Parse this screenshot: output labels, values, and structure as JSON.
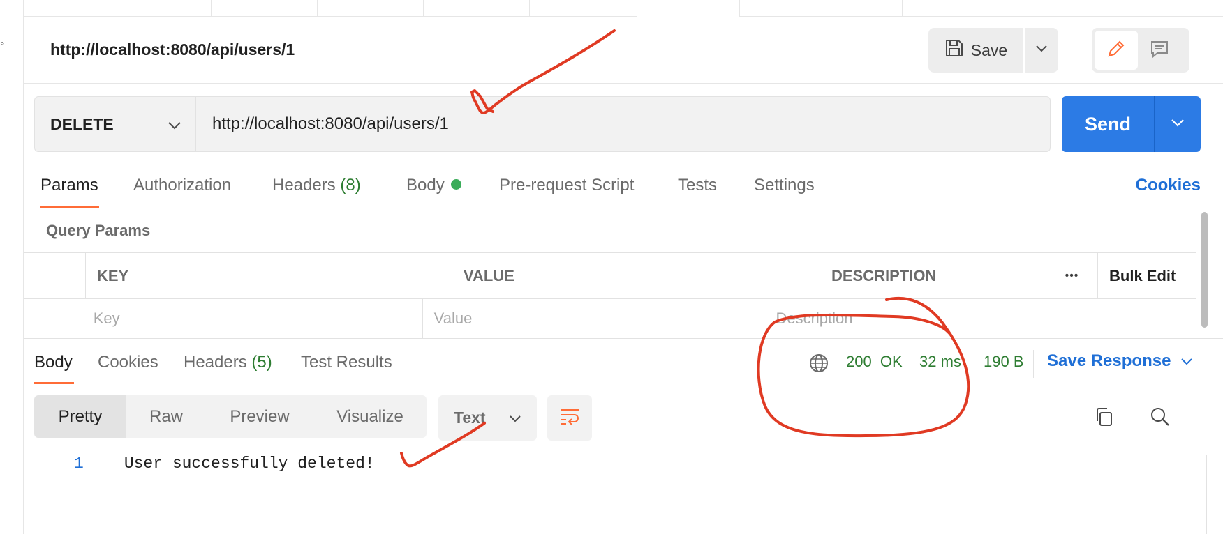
{
  "request": {
    "title": "http://localhost:8080/api/users/1",
    "save_label": "Save",
    "method": "DELETE",
    "url": "http://localhost:8080/api/users/1",
    "send_label": "Send"
  },
  "request_tabs": {
    "params": "Params",
    "authorization": "Authorization",
    "headers": "Headers",
    "headers_count": "(8)",
    "body": "Body",
    "pre_request": "Pre-request Script",
    "tests": "Tests",
    "settings": "Settings",
    "cookies": "Cookies"
  },
  "query_params": {
    "label": "Query Params",
    "columns": [
      "KEY",
      "VALUE",
      "DESCRIPTION"
    ],
    "more_icon": "•••",
    "bulk_edit": "Bulk Edit",
    "placeholders": [
      "Key",
      "Value",
      "Description"
    ]
  },
  "response": {
    "tabs": {
      "body": "Body",
      "cookies": "Cookies",
      "headers": "Headers",
      "headers_count": "(5)",
      "test_results": "Test Results"
    },
    "status_code": "200",
    "status_text": "OK",
    "time": "32 ms",
    "size": "190 B",
    "save_response": "Save Response",
    "view_tabs": [
      "Pretty",
      "Raw",
      "Preview",
      "Visualize"
    ],
    "format": "Text",
    "line_number": "1",
    "body_text": "User successfully deleted!"
  },
  "colors": {
    "accent_orange": "#ff6c37",
    "send_blue": "#2c7be5",
    "link_blue": "#1f6fd6",
    "status_green": "#2e7d32",
    "annotation_red": "#e03a23"
  }
}
